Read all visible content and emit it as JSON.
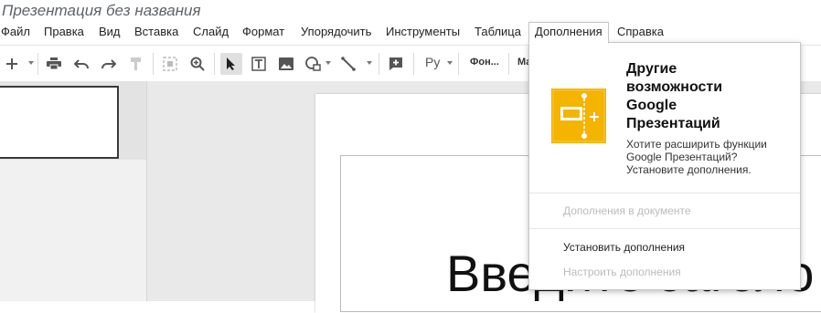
{
  "app": {
    "doc_title": "Презентация без названия"
  },
  "menu": {
    "items": [
      "Файл",
      "Правка",
      "Вид",
      "Вставка",
      "Слайд",
      "Формат",
      "Упорядочить",
      "Инструменты",
      "Таблица",
      "Дополнения",
      "Справка"
    ],
    "active": "Дополнения"
  },
  "toolbar": {
    "icons": [
      "add-icon",
      "print-icon",
      "undo-icon",
      "redo-icon",
      "paint-format-icon",
      "zoom-fit-icon",
      "zoom-icon",
      "select-cursor-icon",
      "text-box-icon",
      "image-icon",
      "shape-icon",
      "line-icon",
      "comment-icon",
      "spellcheck-icon"
    ],
    "spelling_label": "Ру",
    "background_label": "Фон...",
    "truncated_label": "Ма"
  },
  "slide": {
    "title_text": "Введите заголо"
  },
  "addons_menu": {
    "promo_title_lines": [
      "Другие",
      "возможности",
      "Google",
      "Презентаций"
    ],
    "promo_desc_lines": [
      "Хотите расширить функции",
      "Google Презентаций?",
      "Установите дополнения."
    ],
    "section_label": "Дополнения в документе",
    "install_label": "Установить дополнения",
    "manage_label": "Настроить дополнения"
  },
  "colors": {
    "promo_icon": "#f4b400",
    "accent_selected": "#e0e0e0"
  }
}
